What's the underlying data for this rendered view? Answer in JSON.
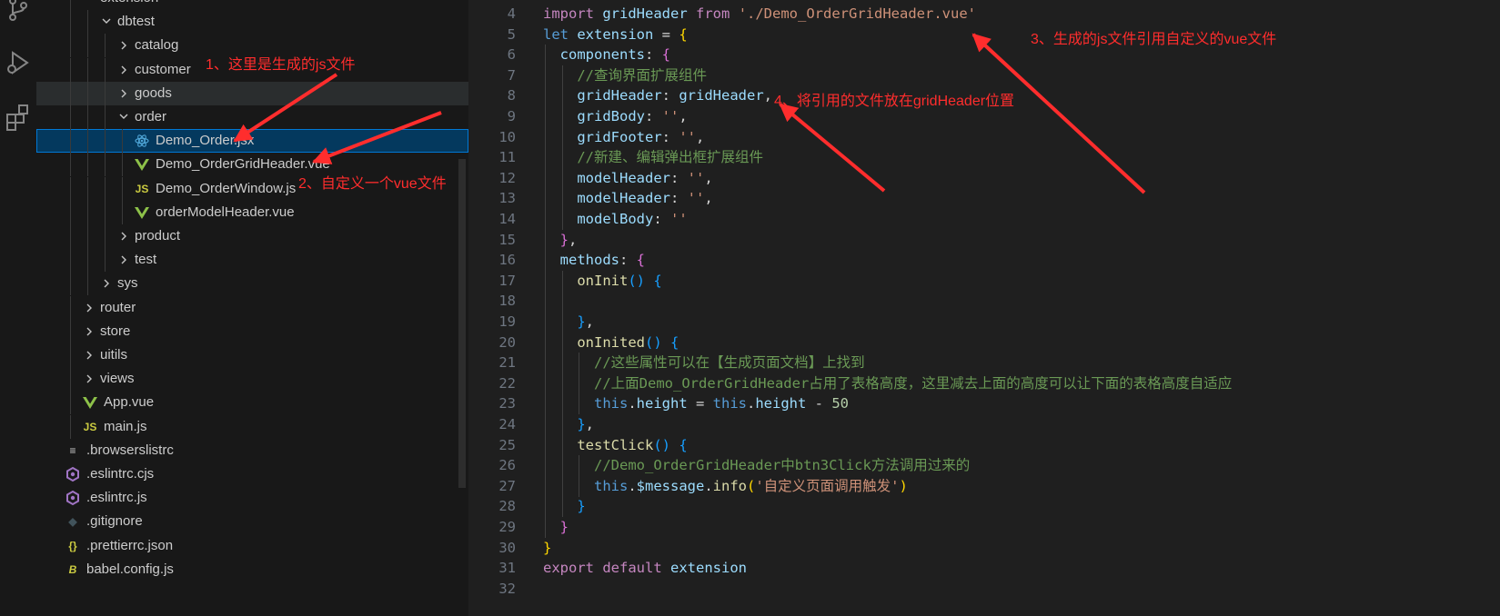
{
  "colors": {
    "annotation": "#ff2d2d",
    "selection": "#04395e",
    "accent": "#0078d4"
  },
  "activity_bar": {
    "icons": [
      "source-control-icon",
      "run-debug-icon",
      "extensions-icon"
    ]
  },
  "explorer": {
    "items": [
      {
        "label": "extension",
        "type": "folder",
        "expanded": true
      },
      {
        "label": "dbtest",
        "type": "folder",
        "expanded": true
      },
      {
        "label": "catalog",
        "type": "folder",
        "expanded": false
      },
      {
        "label": "customer",
        "type": "folder",
        "expanded": false
      },
      {
        "label": "goods",
        "type": "folder",
        "expanded": false
      },
      {
        "label": "order",
        "type": "folder",
        "expanded": true
      },
      {
        "label": "Demo_Order.jsx",
        "type": "file",
        "icon": "react-icon"
      },
      {
        "label": "Demo_OrderGridHeader.vue",
        "type": "file",
        "icon": "vue-icon"
      },
      {
        "label": "Demo_OrderWindow.js",
        "type": "file",
        "icon": "js-icon",
        "icon_text": "JS"
      },
      {
        "label": "orderModelHeader.vue",
        "type": "file",
        "icon": "vue-icon"
      },
      {
        "label": "product",
        "type": "folder",
        "expanded": false
      },
      {
        "label": "test",
        "type": "folder",
        "expanded": false
      },
      {
        "label": "sys",
        "type": "folder",
        "expanded": false
      },
      {
        "label": "router",
        "type": "folder",
        "expanded": false
      },
      {
        "label": "store",
        "type": "folder",
        "expanded": false
      },
      {
        "label": "uitils",
        "type": "folder",
        "expanded": false
      },
      {
        "label": "views",
        "type": "folder",
        "expanded": false
      },
      {
        "label": "App.vue",
        "type": "file",
        "icon": "vue-icon"
      },
      {
        "label": "main.js",
        "type": "file",
        "icon": "js-icon",
        "icon_text": "JS"
      },
      {
        "label": ".browserslistrc",
        "type": "file",
        "icon": "lines-icon",
        "icon_text": "≡"
      },
      {
        "label": ".eslintrc.cjs",
        "type": "file",
        "icon": "eslint-icon"
      },
      {
        "label": ".eslintrc.js",
        "type": "file",
        "icon": "eslint-icon"
      },
      {
        "label": ".gitignore",
        "type": "file",
        "icon": "git-icon",
        "icon_text": "◆"
      },
      {
        "label": ".prettierrc.json",
        "type": "file",
        "icon": "json-icon",
        "icon_text": "{}"
      },
      {
        "label": "babel.config.js",
        "type": "file",
        "icon": "babel-icon",
        "icon_text": "B"
      }
    ]
  },
  "editor": {
    "lines": [
      {
        "n": "4",
        "tokens": [
          [
            "kw",
            "import"
          ],
          [
            "pun",
            " "
          ],
          [
            "var",
            "gridHeader"
          ],
          [
            "pun",
            " "
          ],
          [
            "kw",
            "from"
          ],
          [
            "pun",
            " "
          ],
          [
            "str",
            "'./Demo_OrderGridHeader.vue'"
          ]
        ]
      },
      {
        "n": "5",
        "tokens": [
          [
            "kwb",
            "let"
          ],
          [
            "pun",
            " "
          ],
          [
            "var",
            "extension"
          ],
          [
            "pun",
            " = "
          ],
          [
            "br1",
            "{"
          ]
        ]
      },
      {
        "n": "6",
        "tokens": [
          [
            "pun",
            "  "
          ],
          [
            "var",
            "components"
          ],
          [
            "pun",
            ": "
          ],
          [
            "br2",
            "{"
          ]
        ]
      },
      {
        "n": "7",
        "tokens": [
          [
            "pun",
            "    "
          ],
          [
            "cm",
            "//查询界面扩展组件"
          ]
        ]
      },
      {
        "n": "8",
        "tokens": [
          [
            "pun",
            "    "
          ],
          [
            "var",
            "gridHeader"
          ],
          [
            "pun",
            ": "
          ],
          [
            "var",
            "gridHeader"
          ],
          [
            "pun",
            ","
          ]
        ]
      },
      {
        "n": "9",
        "tokens": [
          [
            "pun",
            "    "
          ],
          [
            "var",
            "gridBody"
          ],
          [
            "pun",
            ": "
          ],
          [
            "str",
            "''"
          ],
          [
            "pun",
            ","
          ]
        ]
      },
      {
        "n": "10",
        "tokens": [
          [
            "pun",
            "    "
          ],
          [
            "var",
            "gridFooter"
          ],
          [
            "pun",
            ": "
          ],
          [
            "str",
            "''"
          ],
          [
            "pun",
            ","
          ]
        ]
      },
      {
        "n": "11",
        "tokens": [
          [
            "pun",
            "    "
          ],
          [
            "cm",
            "//新建、编辑弹出框扩展组件"
          ]
        ]
      },
      {
        "n": "12",
        "tokens": [
          [
            "pun",
            "    "
          ],
          [
            "var",
            "modelHeader"
          ],
          [
            "pun",
            ": "
          ],
          [
            "str",
            "''"
          ],
          [
            "pun",
            ","
          ]
        ]
      },
      {
        "n": "13",
        "tokens": [
          [
            "pun",
            "    "
          ],
          [
            "var",
            "modelHeader"
          ],
          [
            "pun",
            ": "
          ],
          [
            "str",
            "''"
          ],
          [
            "pun",
            ","
          ]
        ]
      },
      {
        "n": "14",
        "tokens": [
          [
            "pun",
            "    "
          ],
          [
            "var",
            "modelBody"
          ],
          [
            "pun",
            ": "
          ],
          [
            "str",
            "''"
          ]
        ]
      },
      {
        "n": "15",
        "tokens": [
          [
            "pun",
            "  "
          ],
          [
            "br2",
            "}"
          ],
          [
            "pun",
            ","
          ]
        ]
      },
      {
        "n": "16",
        "tokens": [
          [
            "pun",
            "  "
          ],
          [
            "var",
            "methods"
          ],
          [
            "pun",
            ": "
          ],
          [
            "br2",
            "{"
          ]
        ]
      },
      {
        "n": "17",
        "tokens": [
          [
            "pun",
            "    "
          ],
          [
            "fn",
            "onInit"
          ],
          [
            "br3",
            "()"
          ],
          [
            "pun",
            " "
          ],
          [
            "br3",
            "{"
          ]
        ]
      },
      {
        "n": "18",
        "tokens": []
      },
      {
        "n": "19",
        "tokens": [
          [
            "pun",
            "    "
          ],
          [
            "br3",
            "}"
          ],
          [
            "pun",
            ","
          ]
        ]
      },
      {
        "n": "20",
        "tokens": [
          [
            "pun",
            "    "
          ],
          [
            "fn",
            "onInited"
          ],
          [
            "br3",
            "()"
          ],
          [
            "pun",
            " "
          ],
          [
            "br3",
            "{"
          ]
        ]
      },
      {
        "n": "21",
        "tokens": [
          [
            "pun",
            "      "
          ],
          [
            "cm",
            "//这些属性可以在【生成页面文档】上找到"
          ]
        ]
      },
      {
        "n": "22",
        "tokens": [
          [
            "pun",
            "      "
          ],
          [
            "cm",
            "//上面Demo_OrderGridHeader占用了表格高度，这里减去上面的高度可以让下面的表格高度自适应"
          ]
        ]
      },
      {
        "n": "23",
        "tokens": [
          [
            "pun",
            "      "
          ],
          [
            "kwb",
            "this"
          ],
          [
            "pun",
            "."
          ],
          [
            "var",
            "height"
          ],
          [
            "pun",
            " = "
          ],
          [
            "kwb",
            "this"
          ],
          [
            "pun",
            "."
          ],
          [
            "var",
            "height"
          ],
          [
            "pun",
            " - "
          ],
          [
            "num",
            "50"
          ]
        ]
      },
      {
        "n": "24",
        "tokens": [
          [
            "pun",
            "    "
          ],
          [
            "br3",
            "}"
          ],
          [
            "pun",
            ","
          ]
        ]
      },
      {
        "n": "25",
        "tokens": [
          [
            "pun",
            "    "
          ],
          [
            "fn",
            "testClick"
          ],
          [
            "br3",
            "()"
          ],
          [
            "pun",
            " "
          ],
          [
            "br3",
            "{"
          ]
        ]
      },
      {
        "n": "26",
        "tokens": [
          [
            "pun",
            "      "
          ],
          [
            "cm",
            "//Demo_OrderGridHeader中btn3Click方法调用过来的"
          ]
        ]
      },
      {
        "n": "27",
        "tokens": [
          [
            "pun",
            "      "
          ],
          [
            "kwb",
            "this"
          ],
          [
            "pun",
            "."
          ],
          [
            "var",
            "$message"
          ],
          [
            "pun",
            "."
          ],
          [
            "fn",
            "info"
          ],
          [
            "br1",
            "("
          ],
          [
            "str",
            "'自定义页面调用触发'"
          ],
          [
            "br1",
            ")"
          ]
        ]
      },
      {
        "n": "28",
        "tokens": [
          [
            "pun",
            "    "
          ],
          [
            "br3",
            "}"
          ]
        ]
      },
      {
        "n": "29",
        "tokens": [
          [
            "pun",
            "  "
          ],
          [
            "br2",
            "}"
          ]
        ]
      },
      {
        "n": "30",
        "tokens": [
          [
            "br1",
            "}"
          ]
        ]
      },
      {
        "n": "31",
        "tokens": [
          [
            "kw",
            "export"
          ],
          [
            "pun",
            " "
          ],
          [
            "kw",
            "default"
          ],
          [
            "pun",
            " "
          ],
          [
            "var",
            "extension"
          ]
        ]
      },
      {
        "n": "32",
        "tokens": []
      }
    ]
  },
  "annotations": {
    "a1": "1、这里是生成的js文件",
    "a2": "2、自定义一个vue文件",
    "a3": "3、生成的js文件引用自定义的vue文件",
    "a4": "4、将引用的文件放在gridHeader位置"
  }
}
